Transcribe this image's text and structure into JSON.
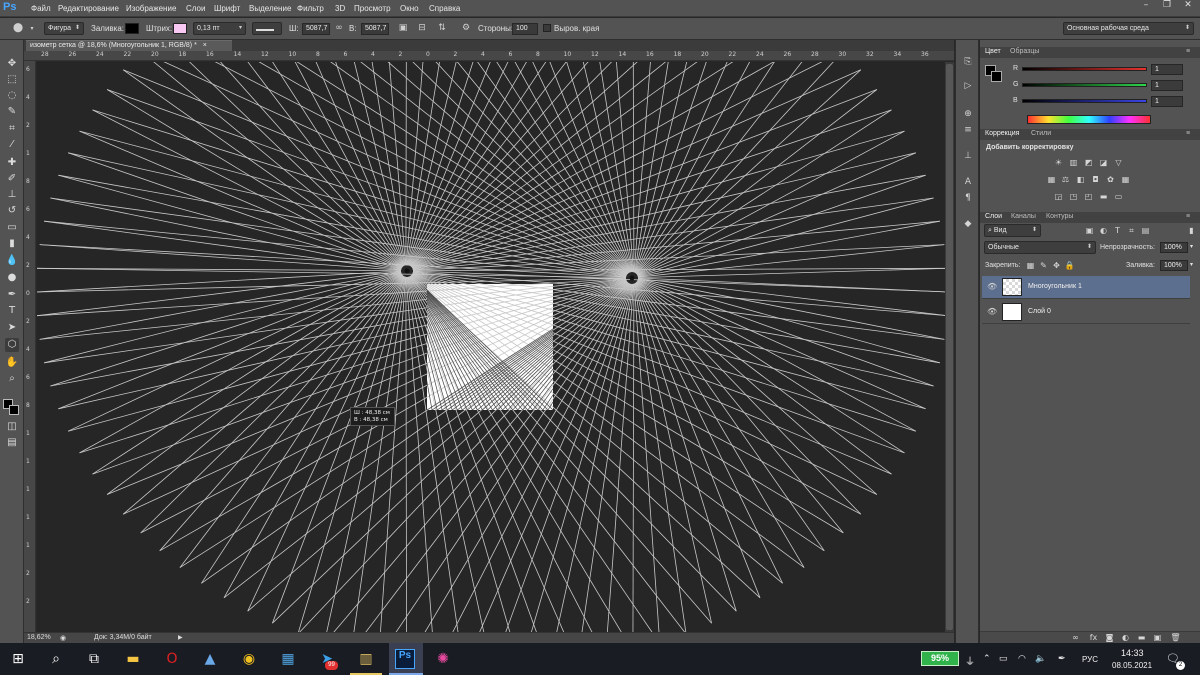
{
  "app": {
    "logo": "Ps"
  },
  "menu": [
    "Файл",
    "Редактирование",
    "Изображение",
    "Слои",
    "Шрифт",
    "Выделение",
    "Фильтр",
    "3D",
    "Просмотр",
    "Окно",
    "Справка"
  ],
  "options": {
    "mode": "Фигура",
    "fill_label": "Заливка:",
    "stroke_label": "Штрих:",
    "stroke_width": "0,13 пт",
    "width_label": "Ш:",
    "width_value": "5087,7",
    "height_label": "В:",
    "height_value": "5087,7",
    "sides_label": "Стороны:",
    "sides_value": "100",
    "align_edges_label": "Выров. края",
    "workspace": "Основная рабочая среда",
    "fill_color": "#000000",
    "stroke_color": "#f9c9f3"
  },
  "document": {
    "tab_title": "изометр сетка @ 18,6% (Многоугольник 1, RGB/8) *",
    "close": "×"
  },
  "rulers": {
    "top": [
      "28",
      "26",
      "24",
      "22",
      "20",
      "18",
      "16",
      "14",
      "12",
      "10",
      "8",
      "6",
      "4",
      "2",
      "0",
      "2",
      "4",
      "6",
      "8",
      "10",
      "12",
      "14",
      "16",
      "18",
      "20",
      "22",
      "24",
      "26",
      "28",
      "30",
      "32",
      "34",
      "36"
    ],
    "left": [
      "6",
      "4",
      "2",
      "1",
      "8",
      "6",
      "4",
      "2",
      "0",
      "2",
      "4",
      "6",
      "8",
      "1",
      "1",
      "1",
      "1",
      "1",
      "2",
      "2"
    ]
  },
  "tooltip": {
    "w": "Ш :   48,38 см",
    "h": "В :   48,38 см"
  },
  "status": {
    "zoom": "18,62%",
    "doc": "Док: 3,34M/0 байт"
  },
  "color_panel": {
    "tabs": [
      "Цвет",
      "Образцы"
    ],
    "channels": [
      {
        "label": "R",
        "value": "1",
        "color": "#e8322e"
      },
      {
        "label": "G",
        "value": "1",
        "color": "#2ed44a"
      },
      {
        "label": "B",
        "value": "1",
        "color": "#3a44e6"
      }
    ]
  },
  "adjust_panel": {
    "tabs": [
      "Коррекция",
      "Стили"
    ],
    "title": "Добавить корректировку"
  },
  "layers_panel": {
    "tabs": [
      "Слои",
      "Каналы",
      "Контуры"
    ],
    "filter": "Вид",
    "blend": "Обычные",
    "opacity_label": "Непрозрачность:",
    "opacity_value": "100%",
    "lock_label": "Закрепить:",
    "fill_label": "Заливка:",
    "fill_value": "100%",
    "layers": [
      {
        "name": "Многоугольник 1",
        "selected": true
      },
      {
        "name": "Слой 0",
        "selected": false
      }
    ]
  },
  "taskbar": {
    "battery": "95%",
    "lang": "РУС",
    "time": "14:33",
    "date": "08.05.2021",
    "badge": "99",
    "notify": "2"
  }
}
